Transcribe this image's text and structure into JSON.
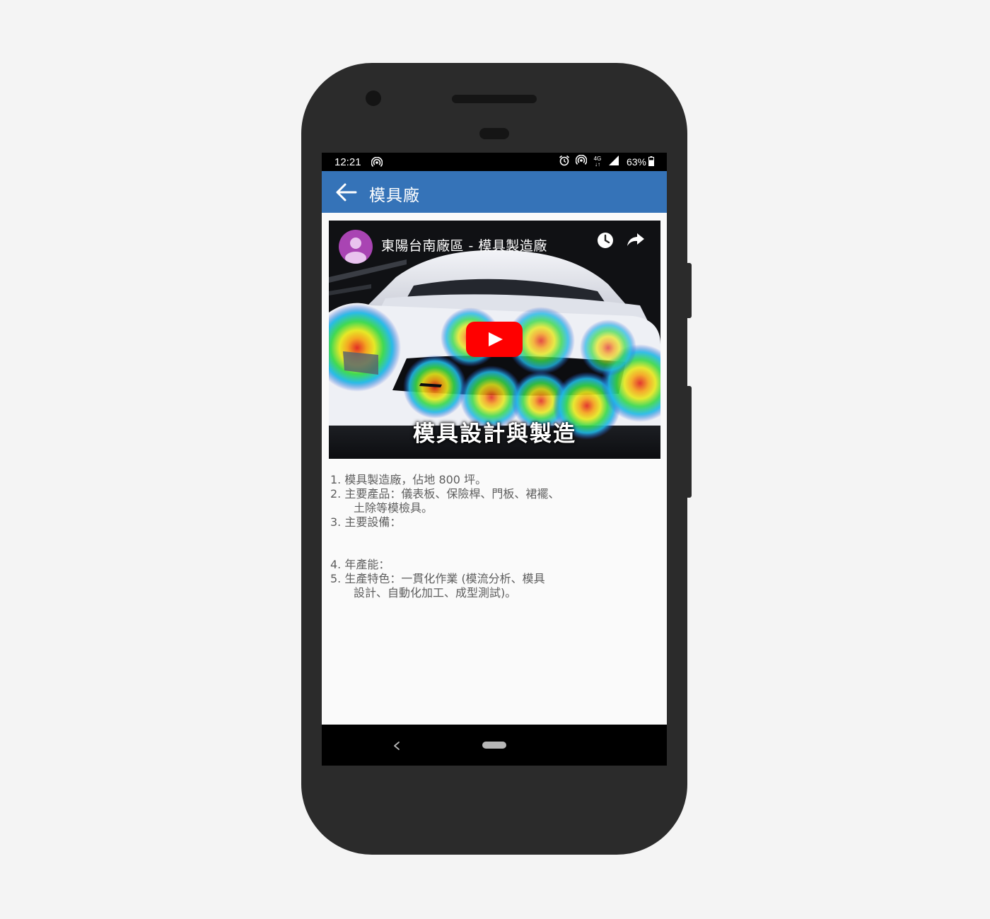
{
  "status_bar": {
    "time": "12:21",
    "battery": "63%",
    "network": "4G",
    "icons": [
      "hotspot-icon",
      "alarm-icon",
      "hotspot-icon",
      "mobile-data-icon",
      "signal-icon",
      "battery-icon"
    ]
  },
  "app_bar": {
    "title": "模具廠",
    "back_icon": "arrow-back-icon",
    "color": "#3573b8"
  },
  "video": {
    "title": "東陽台南廠區 - 模具製造廠",
    "caption": "模具設計與製造",
    "play_icon": "youtube-play-icon",
    "watch_later_icon": "clock-icon",
    "share_icon": "share-icon",
    "play_color": "#ff0000",
    "avatar_color": "#a944b3"
  },
  "description": {
    "lines": [
      "1. 模具製造廠，佔地 800 坪。",
      "2. 主要產品：儀表板、保險桿、門板、裙襬、",
      "土除等模檢具。",
      "3. 主要設備：",
      "4. 年產能：",
      "5. 生產特色：一貫化作業 (模流分析、模具",
      "設計、自動化加工、成型測試)。"
    ]
  },
  "nav_bar": {
    "back_icon": "nav-back-icon",
    "home_icon": "nav-home-pill-icon"
  }
}
